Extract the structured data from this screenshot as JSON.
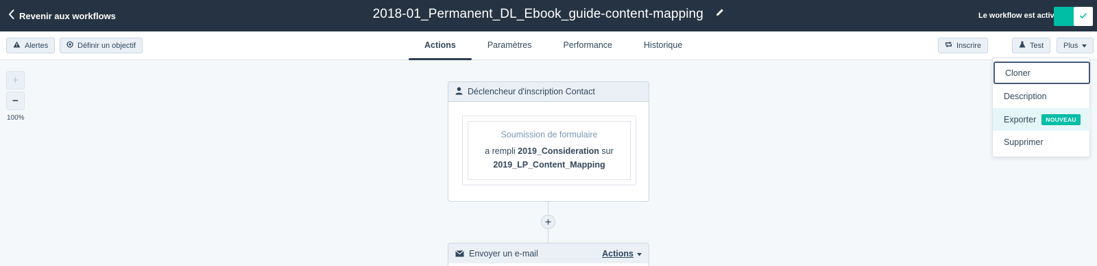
{
  "header": {
    "back_label": "Revenir aux workflows",
    "title": "2018-01_Permanent_DL_Ebook_guide-content-mapping",
    "status_label": "Le workflow est activé",
    "toggle_on": true
  },
  "toolbar": {
    "alerts_label": "Alertes",
    "goal_label": "Définir un objectif",
    "tabs": [
      {
        "label": "Actions",
        "active": true
      },
      {
        "label": "Paramètres",
        "active": false
      },
      {
        "label": "Performance",
        "active": false
      },
      {
        "label": "Historique",
        "active": false
      }
    ],
    "enroll_label": "Inscrire",
    "test_label": "Test",
    "more_label": "Plus"
  },
  "zoom": {
    "plus": "+",
    "minus": "−",
    "level": "100%"
  },
  "trigger": {
    "header": "Déclencheur d'inscription Contact",
    "filter_title": "Soumission de formulaire",
    "filter_prefix": "a rempli",
    "form_name": "2019_Consideration",
    "filter_mid": "sur",
    "page_name": "2019_LP_Content_Mapping"
  },
  "action_card": {
    "header": "Envoyer un e-mail",
    "actions_label": "Actions"
  },
  "more_menu": {
    "items": [
      {
        "label": "Cloner"
      },
      {
        "label": "Description"
      },
      {
        "label": "Exporter",
        "badge": "NOUVEAU"
      },
      {
        "label": "Supprimer"
      }
    ]
  },
  "colors": {
    "topbar": "#253342",
    "accent": "#00bda5",
    "canvas": "#f5f8fa"
  }
}
